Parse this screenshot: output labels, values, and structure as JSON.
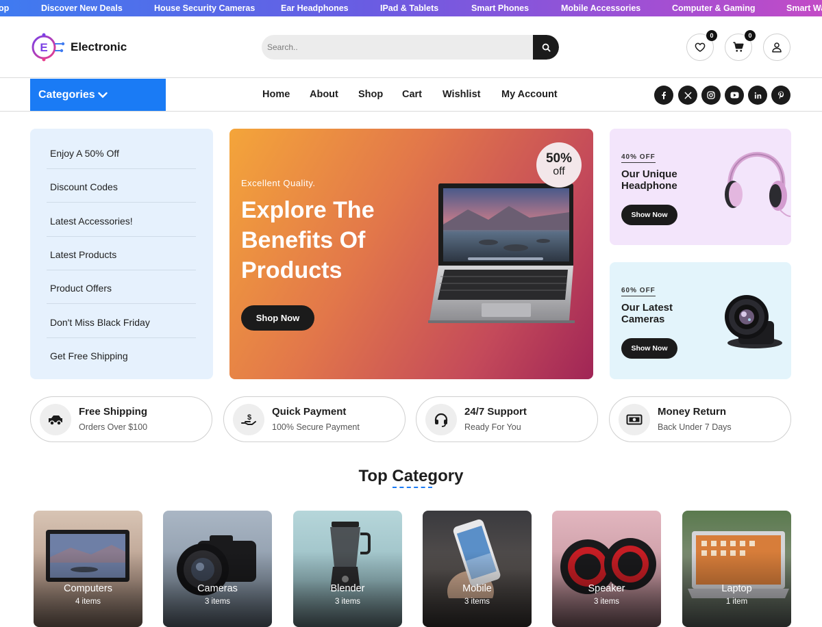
{
  "ticker": [
    "op",
    "Discover New Deals",
    "House Security Cameras",
    "Ear Headphones",
    "IPad & Tablets",
    "Smart Phones",
    "Mobile Accessories",
    "Computer & Gaming",
    "Smart Wa"
  ],
  "header": {
    "logo_text": "Electronic",
    "search_placeholder": "Search..",
    "wishlist_count": "0",
    "cart_count": "0"
  },
  "nav": {
    "categories_label": "Categories",
    "links": [
      "Home",
      "About",
      "Shop",
      "Cart",
      "Wishlist",
      "My Account"
    ],
    "social_icons": [
      "facebook-icon",
      "x-icon",
      "instagram-icon",
      "youtube-icon",
      "linkedin-icon",
      "pinterest-icon"
    ]
  },
  "left_menu": [
    "Enjoy A 50% Off",
    "Discount Codes",
    "Latest Accessories!",
    "Latest Products",
    "Product Offers",
    "Don't Miss Black Friday",
    "Get Free Shipping"
  ],
  "hero": {
    "eyebrow": "Excellent Quality.",
    "title": "Explore The Benefits Of Products",
    "button": "Shop Now",
    "discount_pct": "50%",
    "discount_off": "off"
  },
  "promos": [
    {
      "tag": "40% OFF",
      "title": "Our Unique Headphone",
      "button": "Show Now",
      "bg": "#f3e5fb"
    },
    {
      "tag": "60% OFF",
      "title": "Our Latest Cameras",
      "button": "Show Now",
      "bg": "#e3f4fb"
    }
  ],
  "features": [
    {
      "title": "Free Shipping",
      "sub": "Orders Over $100",
      "icon": "truck-icon"
    },
    {
      "title": "Quick Payment",
      "sub": "100% Secure Payment",
      "icon": "hand-dollar-icon"
    },
    {
      "title": "24/7 Support",
      "sub": "Ready For You",
      "icon": "headset-icon"
    },
    {
      "title": "Money Return",
      "sub": "Back Under 7 Days",
      "icon": "money-icon"
    }
  ],
  "top_category": {
    "title": "Top Category",
    "items": [
      {
        "name": "Computers",
        "count": "4 items"
      },
      {
        "name": "Cameras",
        "count": "3 items"
      },
      {
        "name": "Blender",
        "count": "3 items"
      },
      {
        "name": "Mobile",
        "count": "3 items"
      },
      {
        "name": "Speaker",
        "count": "3 items"
      },
      {
        "name": "Laptop",
        "count": "1 item"
      }
    ]
  },
  "colors": {
    "accent": "#1a7bf5",
    "dark_button": "#1b1b1b",
    "menu_bg": "#e6f1fd"
  }
}
